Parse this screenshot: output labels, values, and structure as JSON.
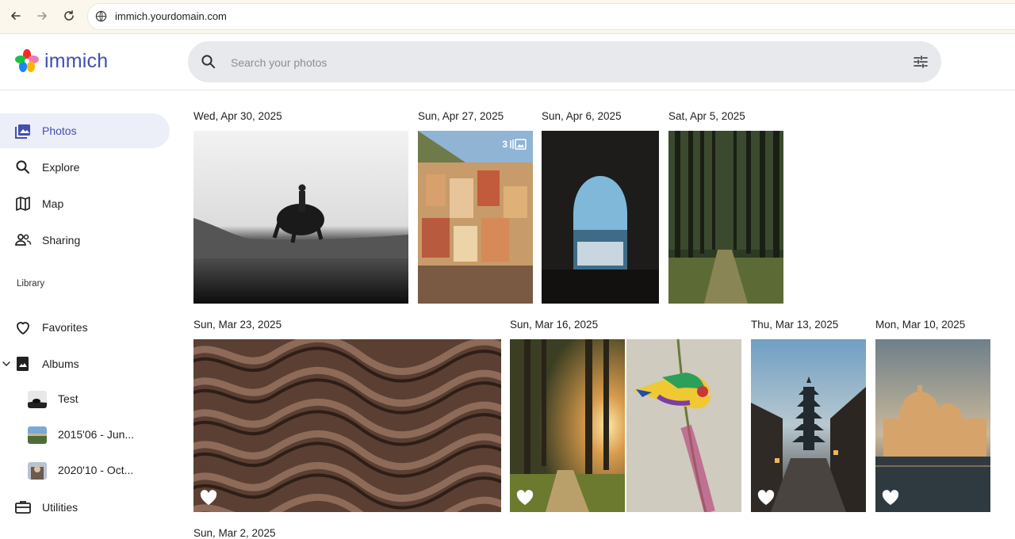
{
  "browser": {
    "url": "immich.yourdomain.com"
  },
  "app": {
    "name": "immich",
    "brand_color": "#4250af"
  },
  "search": {
    "placeholder": "Search your photos"
  },
  "sidebar": {
    "items": [
      {
        "label": "Photos",
        "icon": "photos-icon",
        "active": true
      },
      {
        "label": "Explore",
        "icon": "search-icon"
      },
      {
        "label": "Map",
        "icon": "map-icon"
      },
      {
        "label": "Sharing",
        "icon": "people-icon"
      }
    ],
    "library_label": "Library",
    "library_items": [
      {
        "label": "Favorites",
        "icon": "heart-icon"
      },
      {
        "label": "Albums",
        "icon": "album-icon",
        "expanded": true
      }
    ],
    "albums": [
      {
        "label": "Test"
      },
      {
        "label": "2015'06 - Jun..."
      },
      {
        "label": "2020'10 - Oct..."
      }
    ],
    "utilities_label": "Utilities"
  },
  "timeline": {
    "groups": [
      {
        "date": "Wed, Apr 30, 2025"
      },
      {
        "date": "Sun, Apr 27, 2025",
        "stack_count": "3"
      },
      {
        "date": "Sun, Apr 6, 2025"
      },
      {
        "date": "Sat, Apr 5, 2025"
      },
      {
        "date": "Sun, Mar 23, 2025"
      },
      {
        "date": "Sun, Mar 16, 2025"
      },
      {
        "date": "Thu, Mar 13, 2025"
      },
      {
        "date": "Mon, Mar 10, 2025"
      },
      {
        "date": "Sun, Mar 2, 2025"
      }
    ]
  }
}
